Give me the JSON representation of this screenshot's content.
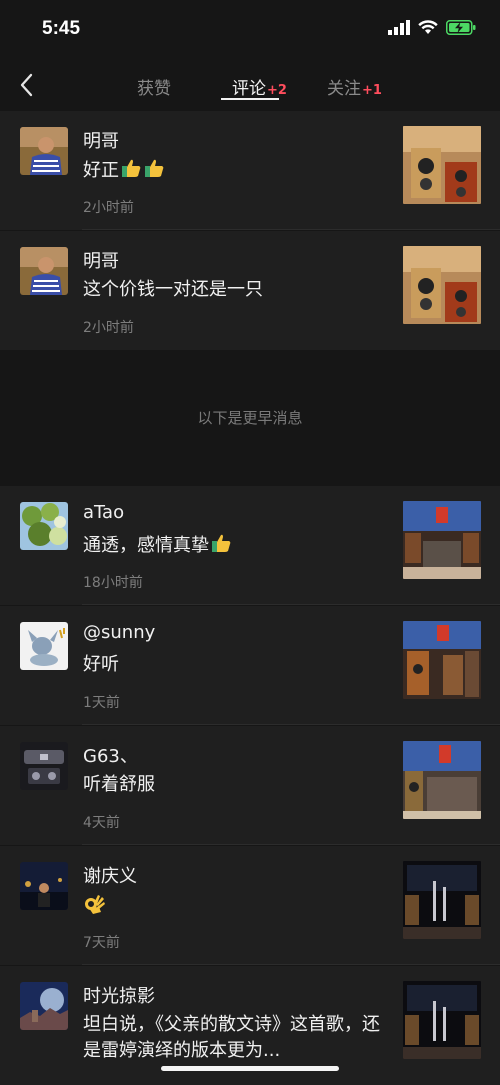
{
  "status": {
    "time": "5:45"
  },
  "nav": {
    "tabs": [
      {
        "label": "获赞",
        "badge": ""
      },
      {
        "label": "评论",
        "badge": "+2"
      },
      {
        "label": "关注",
        "badge": "+1"
      }
    ],
    "active_tab": "评论"
  },
  "separator": "以下是更早消息",
  "comments": [
    {
      "name": "明哥",
      "text": "好正",
      "emoji": [
        "thumbs-up",
        "thumbs-up"
      ],
      "time": "2小时前"
    },
    {
      "name": "明哥",
      "text": "这个价钱一对还是一只",
      "emoji": [],
      "time": "2小时前"
    },
    {
      "name": "aTao",
      "text": "通透，感情真挚",
      "emoji": [
        "thumbs-up"
      ],
      "time": "18小时前"
    },
    {
      "name": "@sunny",
      "text": "好听",
      "emoji": [],
      "time": "1天前"
    },
    {
      "name": "G63、",
      "text": "听着舒服",
      "emoji": [],
      "time": "4天前"
    },
    {
      "name": "谢庆义",
      "text": "",
      "emoji": [
        "ok-hand"
      ],
      "time": "7天前"
    },
    {
      "name": "时光掠影",
      "text": "坦白说，《父亲的散文诗》这首歌，还是雷婷演绎的版本更为...",
      "emoji": [],
      "time": ""
    }
  ],
  "colors": {
    "badge": "#ff4d5d",
    "background": "#161616",
    "card": "#1f1f1f"
  }
}
